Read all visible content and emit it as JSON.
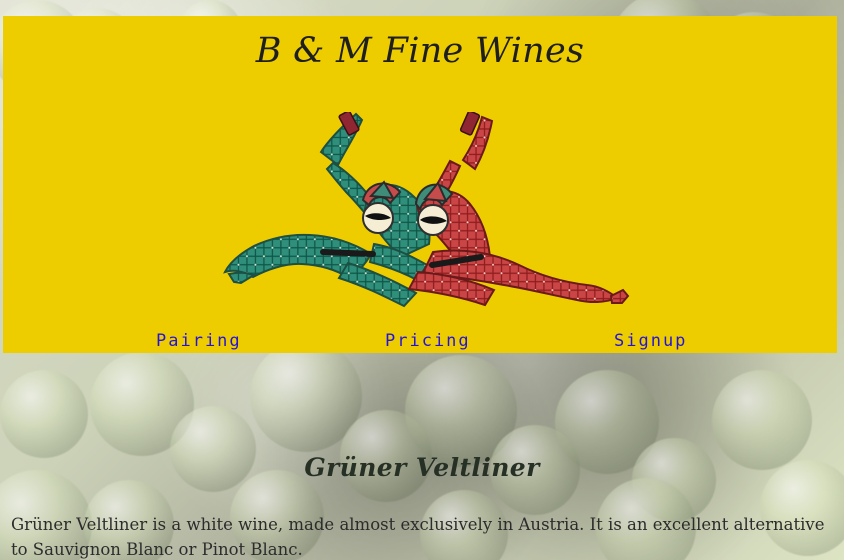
{
  "site": {
    "brand_title": "B & M Fine Wines",
    "brand_color": "#eecd00",
    "background_theme": "white-grapes"
  },
  "navigation": {
    "items": [
      {
        "label": "Pairing"
      },
      {
        "label": "Pricing"
      },
      {
        "label": "Signup"
      }
    ]
  },
  "content": {
    "wine_name": "Grüner Veltliner",
    "description": "Grüner Veltliner is a white wine, made almost exclusively in Austria. It is an excellent alternative to Sauvignon Blanc or Pinot Blanc."
  },
  "illustration": {
    "name": "two-harlequin-jesters-with-wine-bottles"
  },
  "colors": {
    "link": "#2414d9",
    "text": "#2c2c2c"
  }
}
